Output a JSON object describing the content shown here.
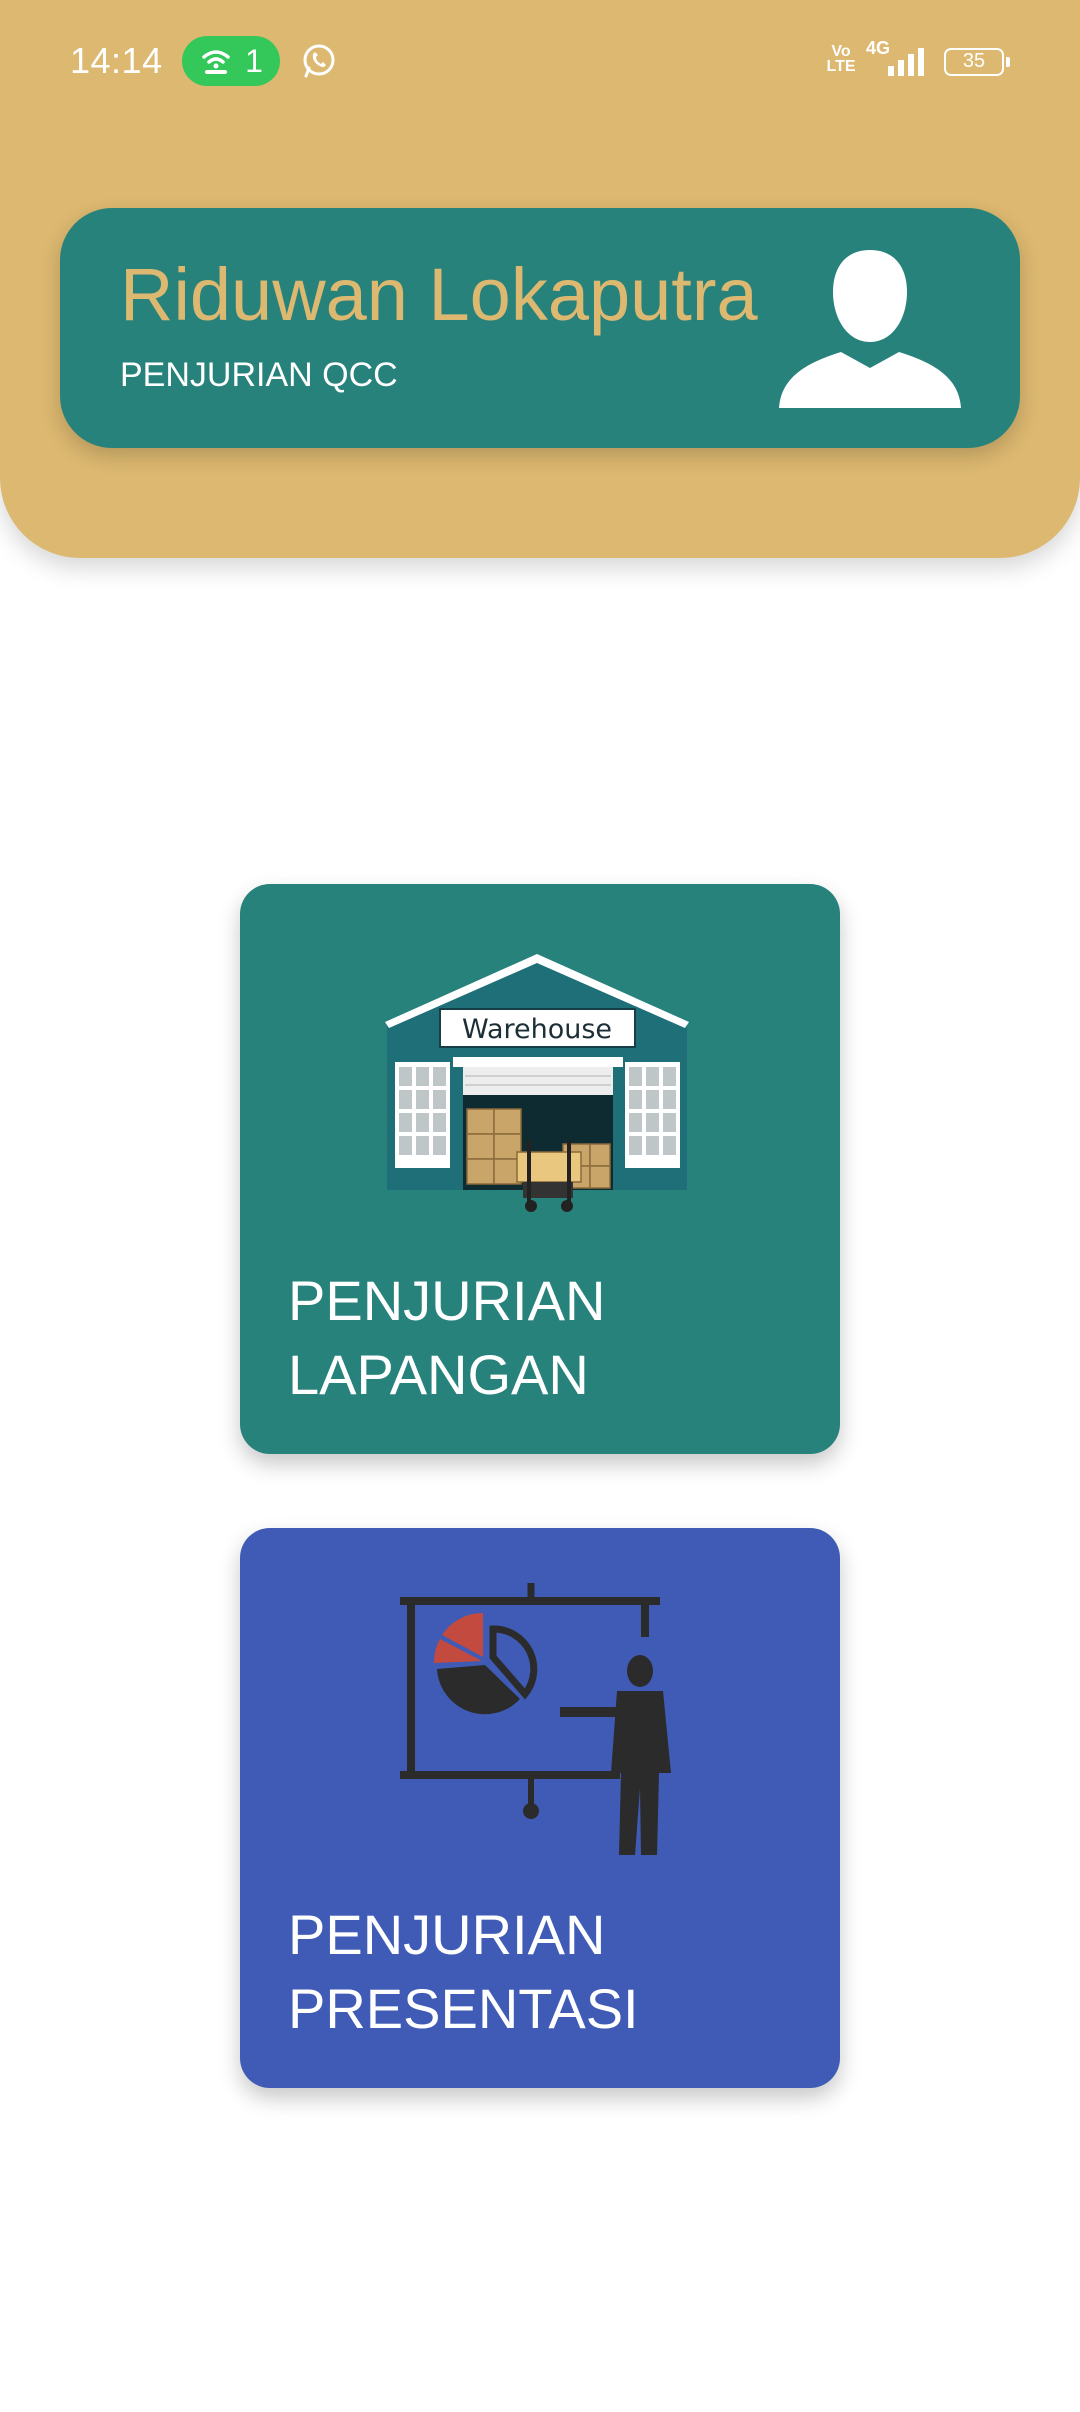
{
  "status_bar": {
    "time": "14:14",
    "hotspot_count": "1",
    "volte": "Vo LTE",
    "network": "4G",
    "battery": "35"
  },
  "profile": {
    "name": "Riduwan Lokaputra",
    "role": "PENJURIAN QCC"
  },
  "menu": {
    "field_judging": {
      "line1": "PENJURIAN",
      "line2": "LAPANGAN",
      "illustration_text": "Warehouse"
    },
    "presentation_judging": {
      "line1": "PENJURIAN",
      "line2": "PRESENTASI"
    }
  },
  "colors": {
    "header_gold": "#DCB870",
    "teal": "#27827B",
    "blue": "#3F5BB5",
    "hotspot_green": "#34C759"
  },
  "icons": [
    "hotspot-icon",
    "whatsapp-icon",
    "signal-icon",
    "battery-icon",
    "user-avatar-icon",
    "warehouse-icon",
    "presentation-icon"
  ]
}
